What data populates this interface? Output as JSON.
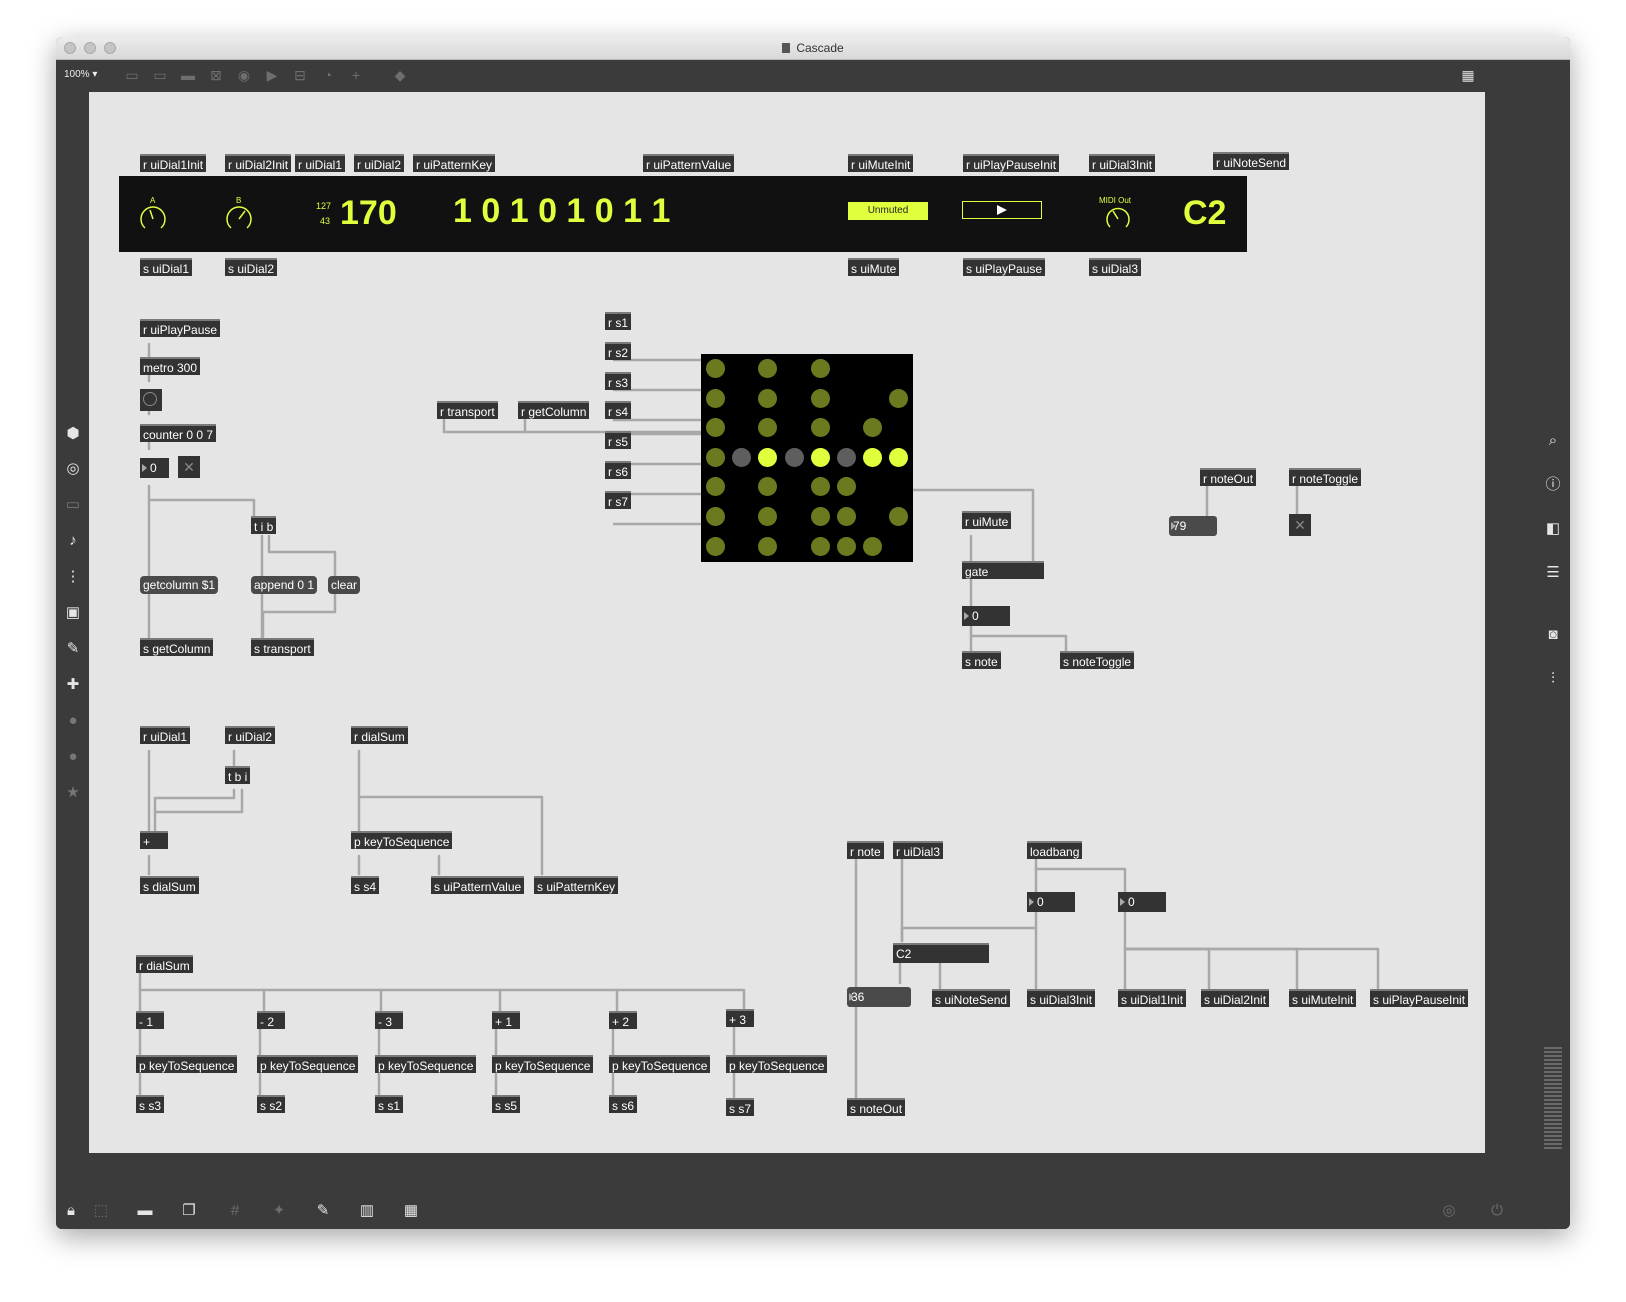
{
  "window": {
    "title": "Cascade"
  },
  "toolbar": {
    "zoom": "100%"
  },
  "presentation": {
    "dial_a_label": "A",
    "dial_b_label": "B",
    "tempo_max": "127",
    "tempo_min": "43",
    "tempo_value": "170",
    "pattern": "1 0 1 0 1 0 1 1",
    "mute_label": "Unmuted",
    "midi_out_label": "MIDI Out",
    "note_name": "C2"
  },
  "colors": {
    "accent": "#e0ff3c",
    "matrix_on": "#6b7a1f",
    "canvas": "#e5e5e5"
  },
  "objects": {
    "o1": "r uiDial1Init",
    "o2": "r uiDial2Init",
    "o3": "r uiDial1",
    "o4": "r uiDial2",
    "o5": "r uiPatternKey",
    "o6": "r uiPatternValue",
    "o7": "r uiMuteInit",
    "o8": "r uiPlayPauseInit",
    "o9": "r uiDial3Init",
    "o10": "r uiNoteSend",
    "o11": "s uiDial1",
    "o12": "s uiDial2",
    "o13": "s uiMute",
    "o14": "s uiPlayPause",
    "o15": "s uiDial3",
    "o16": "r uiPlayPause",
    "o17": "metro 300",
    "o18": "counter 0 0 7",
    "o19": "0",
    "o20": "t i b",
    "o21": "getcolumn $1",
    "o22": "append 0 1",
    "o23": "clear",
    "o24": "s getColumn",
    "o25": "s transport",
    "o26": "r s1",
    "o27": "r s2",
    "o28": "r s3",
    "o29": "r s4",
    "o30": "r s5",
    "o31": "r s6",
    "o32": "r s7",
    "o33": "r transport",
    "o34": "r getColumn",
    "o35": "r uiMute",
    "o36": "gate",
    "o37": "0",
    "o38": "s note",
    "o39": "s noteToggle",
    "o40": "r noteOut",
    "o41": "79",
    "o42": "r noteToggle",
    "o43": "r uiDial1",
    "o44": "r uiDial2",
    "o45": "t b i",
    "o46": "+",
    "o47": "s dialSum",
    "o48": "r dialSum",
    "o49": "p keyToSequence",
    "o50": "s s4",
    "o51": "s uiPatternValue",
    "o52": "s uiPatternKey",
    "o53": "r dialSum",
    "o54": "- 1",
    "o55": "- 2",
    "o56": "- 3",
    "o57": "+ 1",
    "o58": "+ 2",
    "o59": "+ 3",
    "o60": "p keyToSequence",
    "o61": "p keyToSequence",
    "o62": "p keyToSequence",
    "o63": "p keyToSequence",
    "o64": "p keyToSequence",
    "o65": "p keyToSequence",
    "o66": "s s3",
    "o67": "s s2",
    "o68": "s s1",
    "o69": "s s5",
    "o70": "s s6",
    "o71": "s s7",
    "o72": "r note",
    "o73": "r uiDial3",
    "o74": "loadbang",
    "o75": "0",
    "o76": "0",
    "o77": "C2",
    "o78": "36",
    "o79": "s uiNoteSend",
    "o80": "s uiDial3Init",
    "o81": "s uiDial1Init",
    "o82": "s uiDial2Init",
    "o83": "s uiMuteInit",
    "o84": "s uiPlayPauseInit",
    "o85": "s noteOut"
  },
  "matrix": {
    "columns": 8,
    "rows": 7,
    "cells": [
      [
        1,
        0,
        1,
        0,
        1,
        0,
        0,
        0
      ],
      [
        1,
        0,
        1,
        0,
        1,
        0,
        0,
        1
      ],
      [
        1,
        0,
        1,
        0,
        1,
        0,
        1,
        0
      ],
      [
        1,
        2,
        3,
        2,
        3,
        2,
        3,
        3
      ],
      [
        1,
        0,
        1,
        0,
        1,
        1,
        0,
        0
      ],
      [
        1,
        0,
        1,
        0,
        1,
        1,
        0,
        1
      ],
      [
        1,
        0,
        1,
        0,
        1,
        1,
        1,
        0
      ]
    ]
  }
}
